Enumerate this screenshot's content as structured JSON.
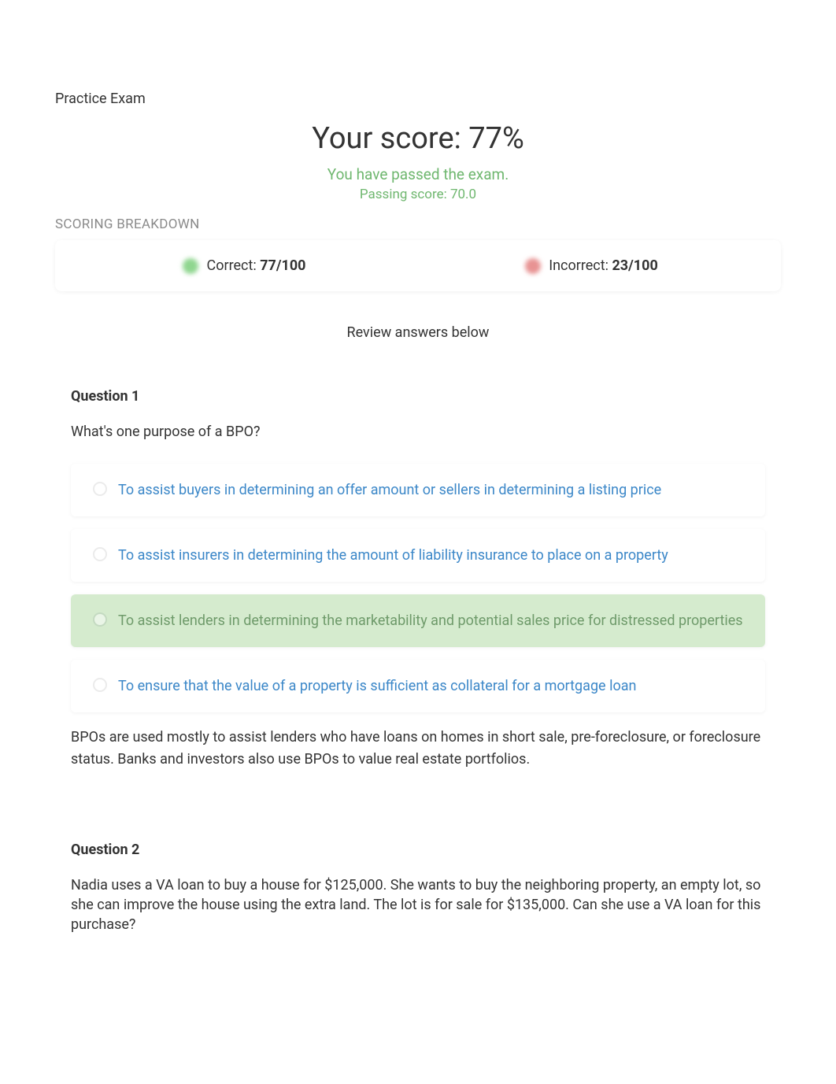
{
  "breadcrumb": "Practice Exam",
  "score": {
    "header": "Your score: 77%",
    "pass_message": "You have passed the exam.",
    "passing_score": "Passing score: 70.0"
  },
  "scoring_breakdown": {
    "label": "SCORING BREAKDOWN",
    "correct_label": "Correct: ",
    "correct_value": "77/100",
    "incorrect_label": "Incorrect: ",
    "incorrect_value": "23/100"
  },
  "review_label": "Review answers below",
  "questions": [
    {
      "title": "Question 1",
      "text": "What's one purpose of a BPO?",
      "options": [
        {
          "text": "To assist buyers in determining an offer amount or sellers in determining a listing price",
          "correct": false
        },
        {
          "text": "To assist insurers in determining the amount of liability insurance to place on a property",
          "correct": false
        },
        {
          "text": "To assist lenders in determining the marketability and potential sales price for distressed properties",
          "correct": true
        },
        {
          "text": "To ensure that the value of a property is sufficient as collateral for a mortgage loan",
          "correct": false
        }
      ],
      "explanation": "BPOs are used mostly to assist lenders who have loans on homes in short sale, pre-foreclosure, or foreclosure status. Banks and investors also use BPOs to value real estate portfolios."
    },
    {
      "title": "Question 2",
      "text": "Nadia uses a VA loan to buy a house for $125,000. She wants to buy the neighboring property, an empty lot, so she can improve the house using the extra land. The lot is for sale for $135,000. Can she use a VA loan for this purchase?",
      "options": [],
      "explanation": ""
    }
  ]
}
